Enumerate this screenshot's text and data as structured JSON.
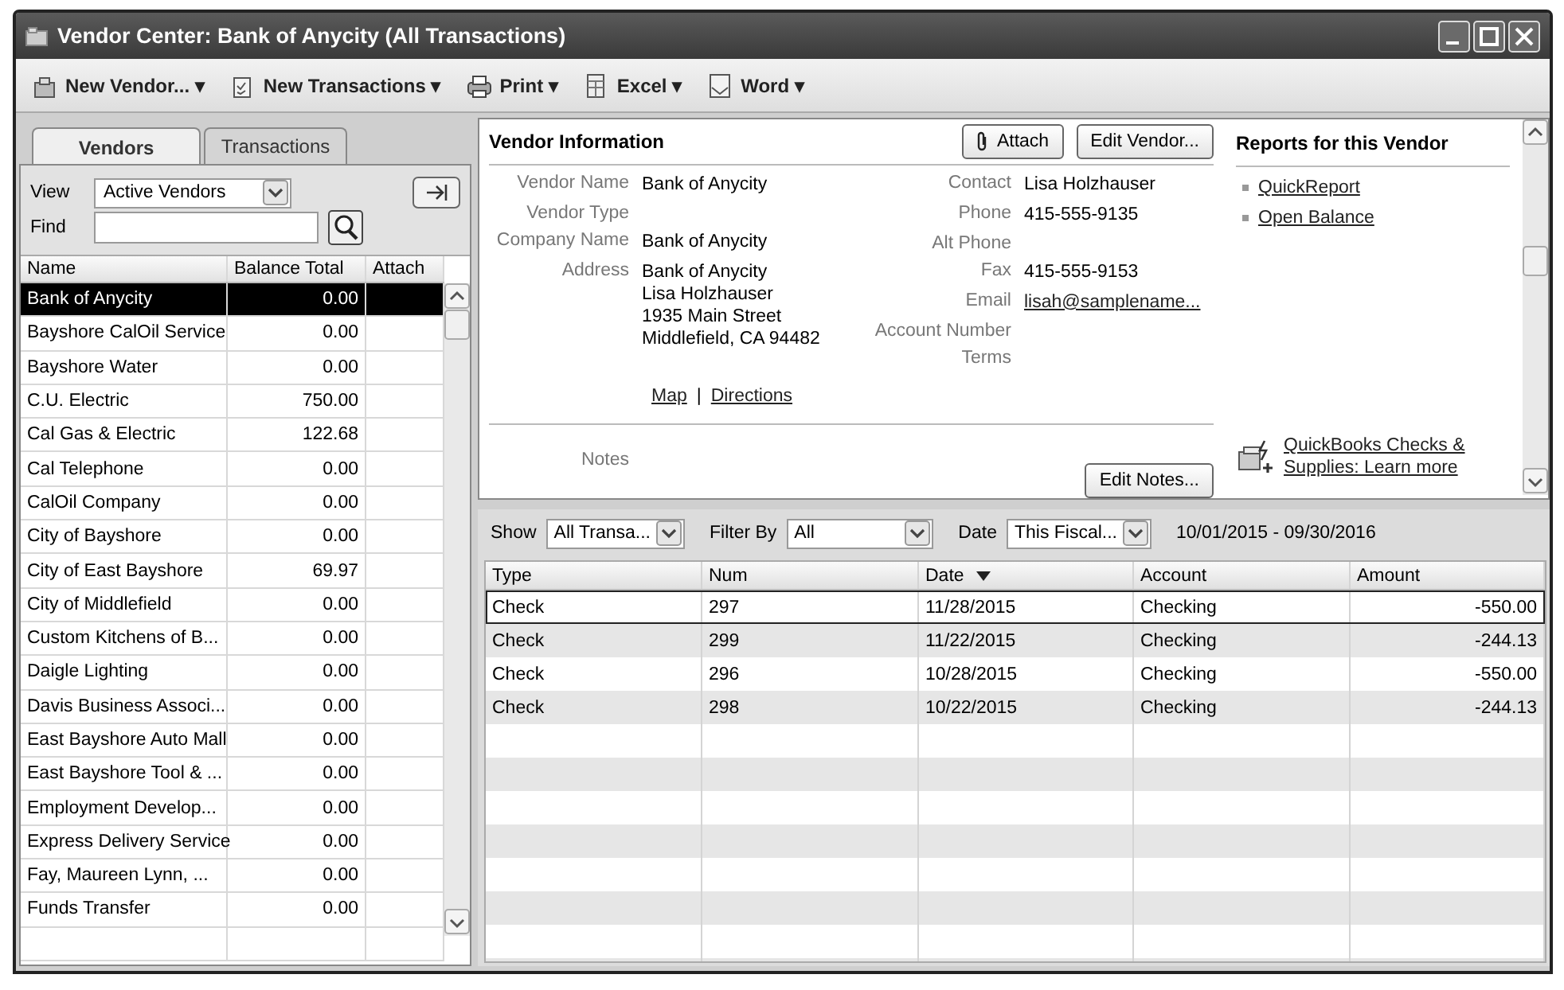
{
  "window": {
    "title": "Vendor Center: Bank of Anycity (All Transactions)"
  },
  "toolbar": [
    {
      "label": "New Vendor...",
      "arrow": "▾"
    },
    {
      "label": "New Transactions",
      "arrow": "▾"
    },
    {
      "label": "Print",
      "arrow": "▾"
    },
    {
      "label": "Excel",
      "arrow": "▾"
    },
    {
      "label": "Word",
      "arrow": "▾"
    }
  ],
  "tabs": [
    {
      "label": "Vendors",
      "selected": true
    },
    {
      "label": "Transactions",
      "selected": false
    }
  ],
  "view": {
    "label": "View",
    "value": "Active Vendors"
  },
  "find": {
    "label": "Find"
  },
  "vendor_table": {
    "columns": [
      "Name",
      "Balance Total",
      "Attach"
    ],
    "rows": [
      {
        "name": "Bank of Anycity",
        "balance": "0.00",
        "selected": true
      },
      {
        "name": "Bayshore CalOil Service",
        "balance": "0.00",
        "selected": false
      },
      {
        "name": "Bayshore Water",
        "balance": "0.00",
        "selected": false
      },
      {
        "name": "C.U. Electric",
        "balance": "750.00",
        "selected": false
      },
      {
        "name": "Cal Gas & Electric",
        "balance": "122.68",
        "selected": false
      },
      {
        "name": "Cal Telephone",
        "balance": "0.00",
        "selected": false
      },
      {
        "name": "CalOil Company",
        "balance": "0.00",
        "selected": false
      },
      {
        "name": "City of Bayshore",
        "balance": "0.00",
        "selected": false
      },
      {
        "name": "City of East Bayshore",
        "balance": "69.97",
        "selected": false
      },
      {
        "name": "City of Middlefield",
        "balance": "0.00",
        "selected": false
      },
      {
        "name": "Custom Kitchens of B...",
        "balance": "0.00",
        "selected": false
      },
      {
        "name": "Daigle Lighting",
        "balance": "0.00",
        "selected": false
      },
      {
        "name": "Davis Business Associ...",
        "balance": "0.00",
        "selected": false
      },
      {
        "name": "East Bayshore Auto Mall",
        "balance": "0.00",
        "selected": false
      },
      {
        "name": "East Bayshore Tool & ...",
        "balance": "0.00",
        "selected": false
      },
      {
        "name": "Employment Develop...",
        "balance": "0.00",
        "selected": false
      },
      {
        "name": "Express Delivery Service",
        "balance": "0.00",
        "selected": false
      },
      {
        "name": "Fay, Maureen Lynn, ...",
        "balance": "0.00",
        "selected": false
      },
      {
        "name": "Funds Transfer",
        "balance": "0.00",
        "selected": false
      }
    ]
  },
  "vendor_info": {
    "title": "Vendor Information",
    "buttons": [
      "Attach",
      "Edit Vendor..."
    ],
    "left_fields": [
      {
        "label": "Vendor Name",
        "lines": [
          "Bank of Anycity"
        ]
      },
      {
        "label": "Vendor Type"
      },
      {
        "label": "Company Name",
        "lines": [
          "Bank of Anycity"
        ]
      },
      {
        "label": "Address",
        "lines": [
          "Bank of Anycity",
          "Lisa Holzhauser",
          "1935 Main Street",
          "Middlefield, CA 94482"
        ]
      }
    ],
    "right_fields": [
      {
        "label": "Contact",
        "value": "Lisa Holzhauser",
        "kind": "text"
      },
      {
        "label": "Phone",
        "value": "415-555-9135",
        "kind": "text"
      },
      {
        "label": "Alt Phone"
      },
      {
        "label": "Fax",
        "value": "415-555-9153",
        "kind": "text"
      },
      {
        "label": "Email",
        "value": "lisah@samplename...",
        "kind": "link"
      },
      {
        "label": "Account Number"
      },
      {
        "label": "Terms"
      }
    ],
    "map_links": [
      "Map",
      "Directions"
    ],
    "map_separator": "|",
    "notes_label": "Notes",
    "notes_button": "Edit Notes..."
  },
  "reports": {
    "title": "Reports for this Vendor",
    "links": [
      "QuickReport",
      "Open Balance"
    ],
    "promo": "QuickBooks Checks & Supplies: Learn more"
  },
  "filters": [
    {
      "label": "Show",
      "value": "All Transa..."
    },
    {
      "label": "Filter By",
      "value": "All"
    },
    {
      "label": "Date",
      "value": "This Fiscal..."
    }
  ],
  "date_range": "10/01/2015 - 09/30/2016",
  "transactions": {
    "columns": [
      {
        "label": "Type",
        "sorted": false
      },
      {
        "label": "Num",
        "sorted": false
      },
      {
        "label": "Date",
        "sorted": true
      },
      {
        "label": "Account",
        "sorted": false
      },
      {
        "label": "Amount",
        "sorted": false
      }
    ],
    "rows": [
      {
        "cells": [
          "Check",
          "297",
          "11/28/2015",
          "Checking",
          "-550.00"
        ],
        "selected": true
      },
      {
        "cells": [
          "Check",
          "299",
          "11/22/2015",
          "Checking",
          "-244.13"
        ],
        "selected": false
      },
      {
        "cells": [
          "Check",
          "296",
          "10/28/2015",
          "Checking",
          "-550.00"
        ],
        "selected": false
      },
      {
        "cells": [
          "Check",
          "298",
          "10/22/2015",
          "Checking",
          "-244.13"
        ],
        "selected": false
      }
    ]
  }
}
